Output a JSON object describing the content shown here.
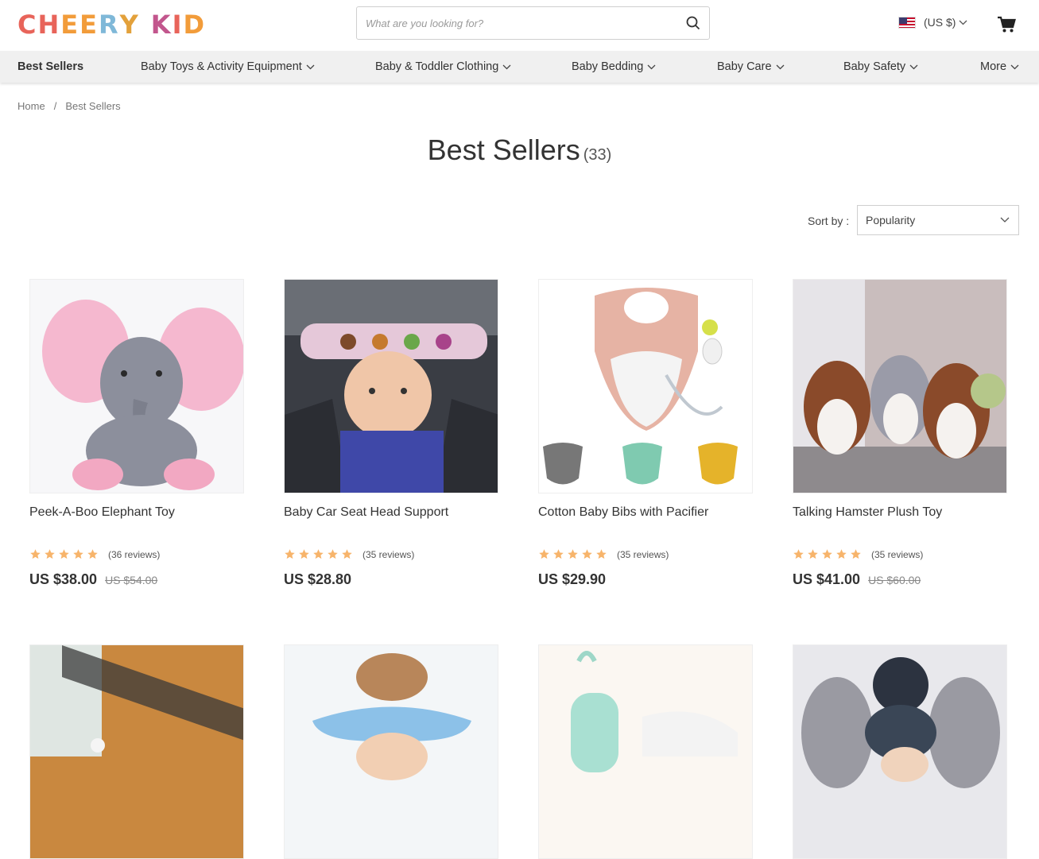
{
  "brand": {
    "logo_letters": [
      "C",
      "H",
      "E",
      "E",
      "R",
      "Y",
      " ",
      "K",
      "I",
      "D"
    ],
    "logo_colors": [
      "#e8645a",
      "#e8645a",
      "#f29c3a",
      "#f29c3a",
      "#7fb8d8",
      "#e3a13b",
      " ",
      "#c2568d",
      "#e8645a",
      "#f29c3a",
      "#9bbf4a"
    ]
  },
  "search": {
    "placeholder": "What are you looking for?"
  },
  "currency": {
    "label": "(US $)"
  },
  "nav": {
    "items": [
      {
        "label": "Best Sellers",
        "dropdown": false,
        "active": true
      },
      {
        "label": "Baby Toys & Activity Equipment",
        "dropdown": true
      },
      {
        "label": "Baby & Toddler Clothing",
        "dropdown": true
      },
      {
        "label": "Baby Bedding",
        "dropdown": true
      },
      {
        "label": "Baby Care",
        "dropdown": true
      },
      {
        "label": "Baby Safety",
        "dropdown": true
      },
      {
        "label": "More",
        "dropdown": true
      }
    ]
  },
  "breadcrumb": {
    "home": "Home",
    "separator": "/",
    "current": "Best Sellers"
  },
  "page": {
    "title": "Best Sellers",
    "count": "(33)"
  },
  "sort": {
    "label": "Sort by :",
    "selected": "Popularity"
  },
  "products": [
    {
      "name": "Peek-A-Boo Elephant Toy",
      "rating": 5,
      "reviews": "(36 reviews)",
      "price": "US $38.00",
      "old_price": "US $54.00"
    },
    {
      "name": "Baby Car Seat Head Support",
      "rating": 5,
      "reviews": "(35 reviews)",
      "price": "US $28.80",
      "old_price": ""
    },
    {
      "name": "Cotton Baby Bibs with Pacifier",
      "rating": 5,
      "reviews": "(35 reviews)",
      "price": "US $29.90",
      "old_price": ""
    },
    {
      "name": "Talking Hamster Plush Toy",
      "rating": 5,
      "reviews": "(35 reviews)",
      "price": "US $41.00",
      "old_price": "US $60.00"
    }
  ],
  "colors": {
    "star": "#f7b46b",
    "nav_bg": "#f0f0f0",
    "text": "#333333"
  }
}
